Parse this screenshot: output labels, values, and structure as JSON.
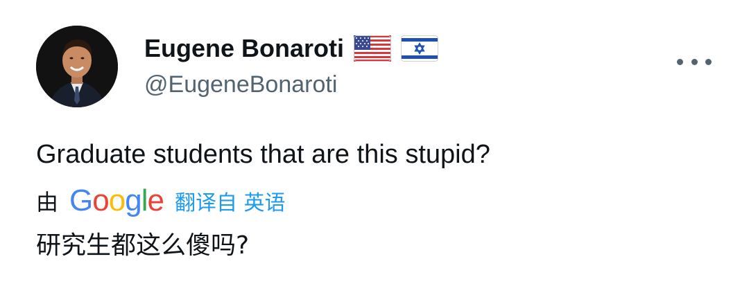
{
  "author": {
    "display_name": "Eugene Bonaroti",
    "handle": "@EugeneBonaroti",
    "flags": [
      "us-flag-icon",
      "israel-flag-icon"
    ]
  },
  "tweet": {
    "text": "Graduate students that are this stupid?"
  },
  "translation": {
    "by_label": "由",
    "provider_letters": [
      "G",
      "o",
      "o",
      "g",
      "l",
      "e"
    ],
    "link_label": "翻译自 英语",
    "translated_text": "研究生都这么傻吗?"
  },
  "icons": {
    "more": "more-options-icon",
    "avatar": "profile-avatar"
  },
  "colors": {
    "text": "#0f1419",
    "secondary": "#536471",
    "link": "#1d9bf0"
  }
}
